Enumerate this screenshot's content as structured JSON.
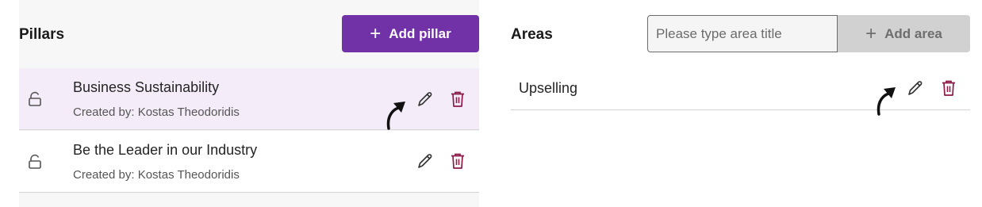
{
  "pillars": {
    "title": "Pillars",
    "add_button": {
      "icon": "plus-icon",
      "label": "Add pillar"
    },
    "items": [
      {
        "title": "Business Sustainability",
        "created_by": "Created by: Kostas Theodoridis",
        "selected": true
      },
      {
        "title": "Be the Leader in our Industry",
        "created_by": "Created by: Kostas Theodoridis",
        "selected": false
      }
    ]
  },
  "areas": {
    "title": "Areas",
    "input": {
      "placeholder": "Please type area title",
      "value": ""
    },
    "add_button": {
      "icon": "plus-icon",
      "label": "Add area",
      "disabled": true
    },
    "items": [
      {
        "title": "Upselling"
      }
    ]
  },
  "colors": {
    "primary": "#7232a7",
    "selected_row": "#f4edf9",
    "delete": "#8b1a47",
    "disabled_button": "#d1d1d1"
  }
}
